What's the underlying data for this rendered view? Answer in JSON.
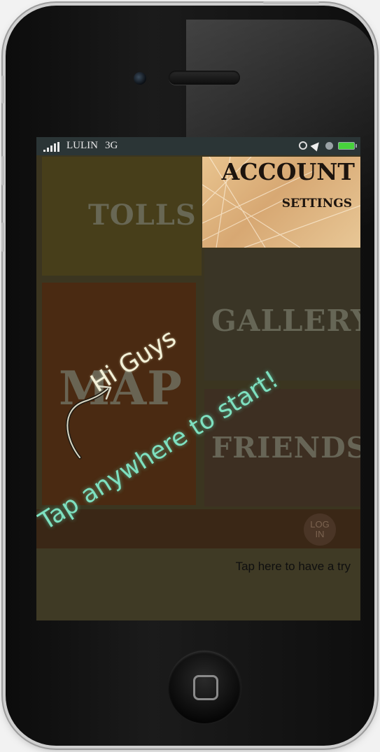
{
  "status_bar": {
    "carrier": "LULIN",
    "network": "3G"
  },
  "tiles": {
    "tolls": "TOLLS",
    "map": "MAP",
    "gallery": "GALLERY",
    "friends": "FRIENDS",
    "account_title": "ACCOUNT",
    "account_subtitle": "SETTINGS"
  },
  "login_button": {
    "line1": "LOG",
    "line2": "IN"
  },
  "try_hint": "Tap here to have a try",
  "overlay": {
    "greeting": "Hi Guys",
    "instruction": "Tap anywhere to start!"
  },
  "colors": {
    "accent_glow": "#7ee0c0",
    "battery": "#47d23c"
  }
}
